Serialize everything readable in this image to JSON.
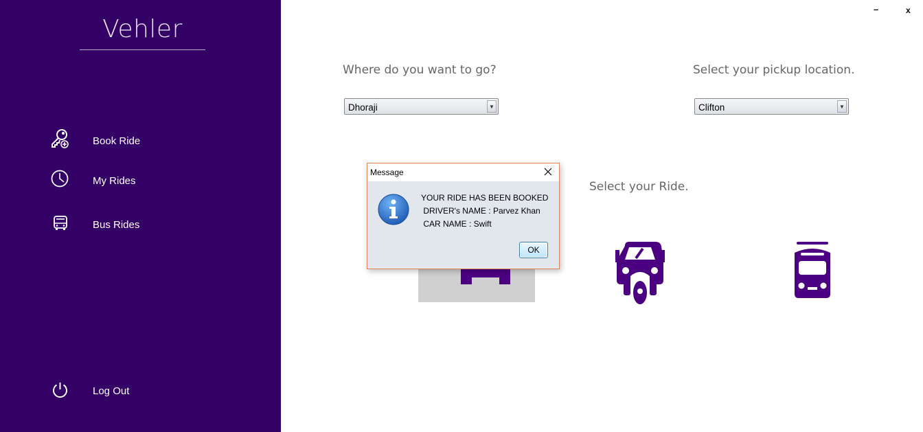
{
  "app": {
    "title": "Vehler"
  },
  "window": {
    "minimize_label": "–",
    "close_label": "x"
  },
  "sidebar": {
    "items": [
      {
        "label": "Book Ride",
        "icon": "key-add-icon"
      },
      {
        "label": "My Rides",
        "icon": "clock-icon"
      },
      {
        "label": "Bus Rides",
        "icon": "bus-icon"
      }
    ],
    "logout": {
      "label": "Log Out",
      "icon": "power-icon"
    }
  },
  "main": {
    "destination_prompt": "Where do you want to go?",
    "destination_value": "Dhoraji",
    "pickup_prompt": "Select your pickup location.",
    "pickup_value": "Clifton",
    "ride_prompt": "Select your Ride.",
    "rides": [
      "car",
      "rickshaw",
      "train"
    ],
    "accent_color": "#4b0082"
  },
  "dialog": {
    "title": "Message",
    "line1": "YOUR RIDE HAS BEEN BOOKED",
    "line2": " DRIVER's NAME : Parvez Khan",
    "line3": " CAR NAME : Swift",
    "ok_label": "OK",
    "icon": "info-icon"
  },
  "colors": {
    "sidebar": "#330066",
    "dialog_border": "#e1855a"
  }
}
